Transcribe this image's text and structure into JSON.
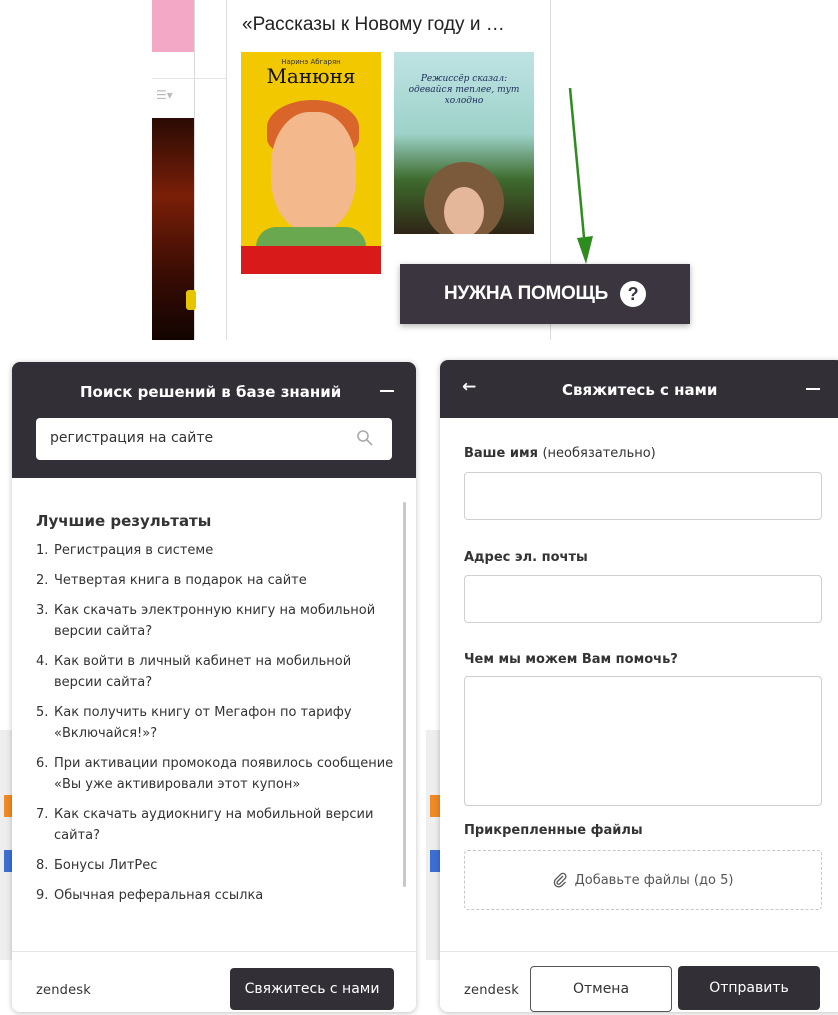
{
  "book": {
    "title": "«Рассказы к Новому году и …",
    "cover1": {
      "author": "Наринэ Абгарян",
      "title": "Манюня"
    },
    "cover2": {
      "text": "Режиссёр сказал: одевайся теплее, тут холодно"
    }
  },
  "help_button": {
    "label": "НУЖНА ПОМОЩЬ",
    "icon": "question-circle-icon"
  },
  "colors": {
    "header": "#332f37",
    "help_button": "#3b3540",
    "arrow": "#2e8b1e"
  },
  "search_panel": {
    "title": "Поиск решений в базе знаний",
    "search_value": "регистрация на сайте",
    "results_heading": "Лучшие результаты",
    "results": [
      {
        "num": "1.",
        "text": "Регистрация в системе"
      },
      {
        "num": "2.",
        "text": "Четвертая книга в подарок на сайте"
      },
      {
        "num": "3.",
        "text": "Как скачать электронную книгу на мобильной версии сайта?"
      },
      {
        "num": "4.",
        "text": "Как войти в личный кабинет на мобильной версии сайта?"
      },
      {
        "num": "5.",
        "text": "Как получить книгу от Мегафон по тарифу «Включайся!»?"
      },
      {
        "num": "6.",
        "text": "При активации промокода появилось сообщение «Вы уже активировали этот купон»"
      },
      {
        "num": "7.",
        "text": "Как скачать аудиокнигу на мобильной версии сайта?"
      },
      {
        "num": "8.",
        "text": "Бонусы ЛитРес"
      },
      {
        "num": "9.",
        "text": "Обычная реферальная ссылка"
      }
    ],
    "brand": "zendesk",
    "contact_button": "Свяжитесь с нами"
  },
  "contact_panel": {
    "title": "Свяжитесь с нами",
    "name_label": "Ваше имя",
    "name_optional": "(необязательно)",
    "email_label": "Адрес эл. почты",
    "message_label": "Чем мы можем Вам помочь?",
    "attachments_label": "Прикрепленные файлы",
    "attach_text": "Добавьте файлы (до 5)",
    "brand": "zendesk",
    "cancel_button": "Отмена",
    "send_button": "Отправить"
  }
}
